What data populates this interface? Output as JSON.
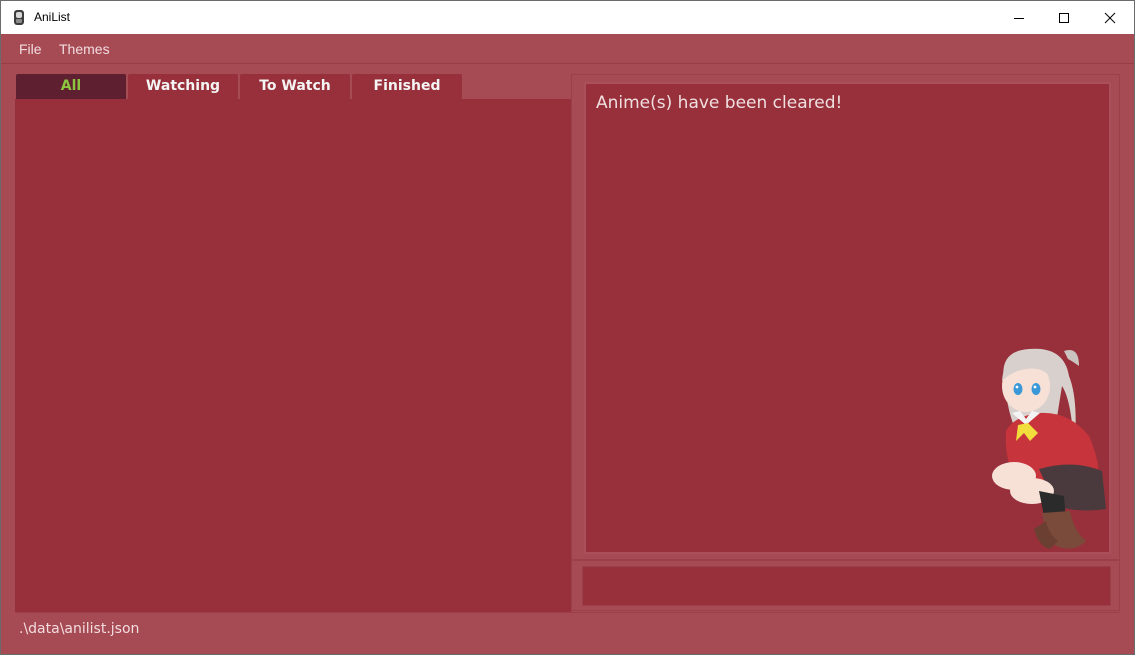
{
  "window": {
    "title": "AniList",
    "controls": {
      "minimize": "minimize",
      "maximize": "maximize",
      "close": "close"
    }
  },
  "menu": {
    "items": [
      {
        "label": "File"
      },
      {
        "label": "Themes"
      }
    ]
  },
  "tabs": [
    {
      "label": "All",
      "active": true
    },
    {
      "label": "Watching",
      "active": false
    },
    {
      "label": "To Watch",
      "active": false
    },
    {
      "label": "Finished",
      "active": false
    }
  ],
  "result_display": {
    "message": "Anime(s) have been cleared!"
  },
  "command_box": {
    "value": "",
    "placeholder": ""
  },
  "status_bar": {
    "file_path": ".\\data\\anilist.json"
  },
  "theme": {
    "background": "#a64a53",
    "panel": "#97303a",
    "active_tab": "#5e2030",
    "active_tab_text": "#8cc63e",
    "text": "#f2dde0"
  },
  "icons": {
    "app": "anilist-app-icon",
    "minimize": "minimize-icon",
    "maximize": "maximize-icon",
    "close": "close-icon"
  }
}
